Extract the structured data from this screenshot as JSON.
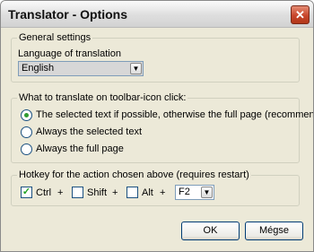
{
  "window": {
    "title": "Translator - Options",
    "close_glyph": "✕"
  },
  "general": {
    "legend": "General settings",
    "language_label": "Language of translation",
    "language_value": "English"
  },
  "translate": {
    "legend": "What to translate on toolbar-icon click:",
    "options": [
      {
        "label": "The selected text if possible, otherwise the full page (recommended)",
        "selected": true
      },
      {
        "label": "Always the selected text",
        "selected": false
      },
      {
        "label": "Always the full page",
        "selected": false
      }
    ]
  },
  "hotkey": {
    "legend": "Hotkey for the action chosen above (requires restart)",
    "ctrl_label": "Ctrl",
    "ctrl_checked": true,
    "shift_label": "Shift",
    "shift_checked": false,
    "alt_label": "Alt",
    "alt_checked": false,
    "plus": "+",
    "key_value": "F2",
    "check_glyph": "✓",
    "arrow_glyph": "▼"
  },
  "buttons": {
    "ok": "OK",
    "cancel": "Mégse"
  },
  "colors": {
    "accent_check": "#21a121",
    "close_button": "#c8462c"
  }
}
